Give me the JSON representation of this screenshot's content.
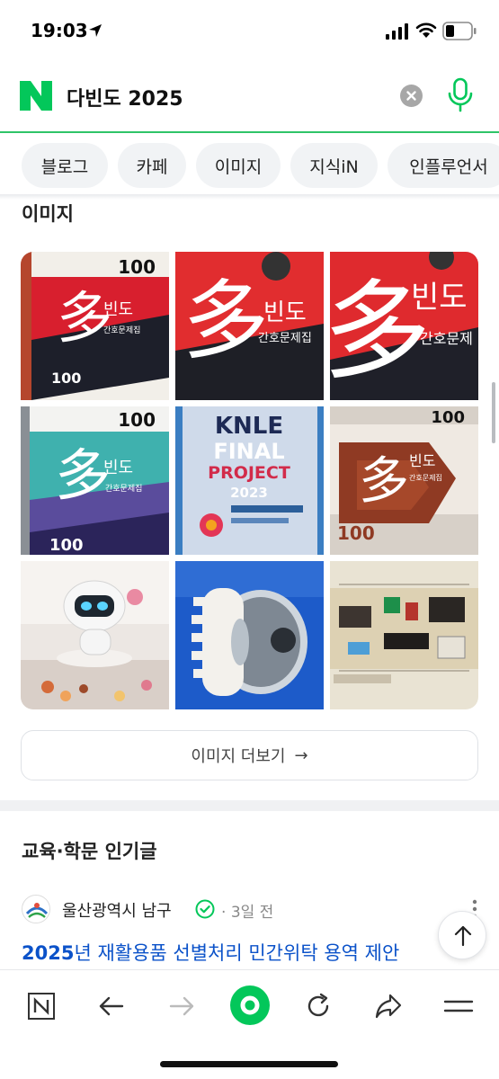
{
  "status_bar": {
    "time": "19:03"
  },
  "search": {
    "query": "다빈도 2025"
  },
  "chips": [
    {
      "label": "블로그"
    },
    {
      "label": "카페"
    },
    {
      "label": "이미지"
    },
    {
      "label": "지식iN"
    },
    {
      "label": "인플루언서"
    }
  ],
  "images_section": {
    "title": "이미지",
    "more_label": "이미지 더보기",
    "more_arrow": "→",
    "thumbs": [
      {
        "subject": "nursing-book-cover-red",
        "texts": [
          "100",
          "多",
          "빈도",
          "간호문제집",
          "100"
        ]
      },
      {
        "subject": "nursing-book-cover-closeup",
        "texts": [
          "多",
          "빈도",
          "간호문제집"
        ]
      },
      {
        "subject": "nursing-book-cover-closeup-2",
        "texts": [
          "多",
          "빈도",
          "간호문제"
        ]
      },
      {
        "subject": "nursing-book-cover-teal",
        "texts": [
          "100",
          "多",
          "빈도",
          "간호문제집",
          "100"
        ]
      },
      {
        "subject": "knle-final-project-book",
        "texts": [
          "KNLE",
          "FINAL",
          "PROJECT",
          "2023"
        ]
      },
      {
        "subject": "nursing-book-cover-brown",
        "texts": [
          "100",
          "多",
          "빈도",
          "간호문제집",
          "100"
        ]
      },
      {
        "subject": "robot-toy-photo",
        "texts": []
      },
      {
        "subject": "white-gear-part-photo",
        "texts": []
      },
      {
        "subject": "circuit-board-photo",
        "texts": []
      }
    ]
  },
  "popular_section": {
    "title": "교육·학문 인기글",
    "author": "울산광역시 남구",
    "separator": "·",
    "time": "3일 전",
    "post_title_highlight": "2025",
    "post_title_rest": "년 재활용품 선별처리 민간위탁 용역 제안"
  },
  "colors": {
    "naver_green": "#03c75a",
    "link_blue": "#0b52c9",
    "chip_bg": "#f1f3f5"
  },
  "icons": [
    "location-arrow-icon",
    "signal-icon",
    "wifi-icon",
    "battery-icon",
    "naver-logo-icon",
    "clear-icon",
    "mic-icon",
    "verified-icon",
    "more-vertical-icon",
    "arrow-up-icon",
    "naver-home-icon",
    "back-icon",
    "forward-icon",
    "green-dot-icon",
    "refresh-icon",
    "share-icon",
    "menu-icon"
  ]
}
